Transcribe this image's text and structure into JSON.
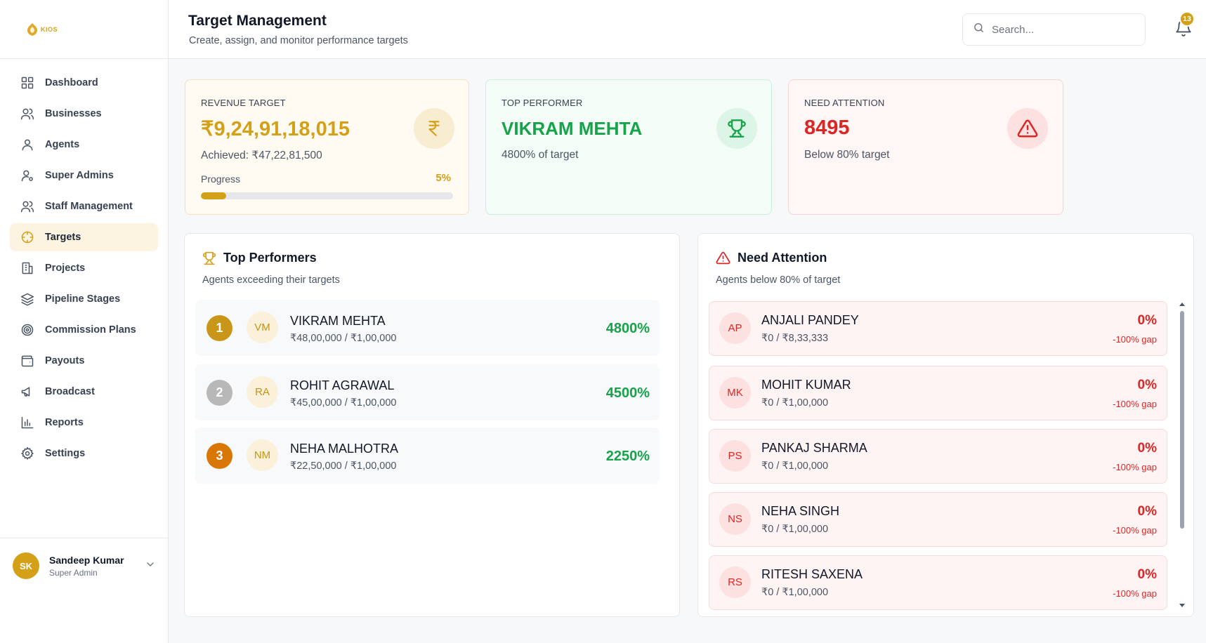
{
  "app": {
    "logo_text": "KIOS"
  },
  "sidebar": {
    "items": [
      {
        "label": "Dashboard",
        "icon": "grid-icon"
      },
      {
        "label": "Businesses",
        "icon": "users-icon"
      },
      {
        "label": "Agents",
        "icon": "user-icon"
      },
      {
        "label": "Super Admins",
        "icon": "user-cog-icon"
      },
      {
        "label": "Staff Management",
        "icon": "users-icon"
      },
      {
        "label": "Targets",
        "icon": "target-icon",
        "active": true
      },
      {
        "label": "Projects",
        "icon": "building-icon"
      },
      {
        "label": "Pipeline Stages",
        "icon": "layers-icon"
      },
      {
        "label": "Commission Plans",
        "icon": "radio-target-icon"
      },
      {
        "label": "Payouts",
        "icon": "wallet-icon"
      },
      {
        "label": "Broadcast",
        "icon": "megaphone-icon"
      },
      {
        "label": "Reports",
        "icon": "bar-chart-icon"
      },
      {
        "label": "Settings",
        "icon": "gear-icon"
      }
    ],
    "user": {
      "initials": "SK",
      "name": "Sandeep Kumar",
      "role": "Super Admin"
    }
  },
  "header": {
    "title": "Target Management",
    "subtitle": "Create, assign, and monitor performance targets",
    "search_placeholder": "Search...",
    "notification_count": "13"
  },
  "stats": {
    "revenue": {
      "label": "REVENUE TARGET",
      "value": "₹9,24,91,18,015",
      "achieved": "Achieved: ₹47,22,81,500",
      "progress_label": "Progress",
      "progress_text": "5%",
      "progress_fraction": 0.05
    },
    "top_performer": {
      "label": "TOP PERFORMER",
      "value": "VIKRAM MEHTA",
      "sub": "4800% of target"
    },
    "need_attention": {
      "label": "NEED ATTENTION",
      "value": "8495",
      "sub": "Below 80% target"
    }
  },
  "top_performers": {
    "title": "Top Performers",
    "subtitle": "Agents exceeding their targets",
    "rows": [
      {
        "rank": "1",
        "initials": "VM",
        "name": "VIKRAM MEHTA",
        "amount": "₹48,00,000 / ₹1,00,000",
        "pct": "4800%",
        "rank_color": "#c9961a"
      },
      {
        "rank": "2",
        "initials": "RA",
        "name": "ROHIT AGRAWAL",
        "amount": "₹45,00,000 / ₹1,00,000",
        "pct": "4500%",
        "rank_color": "#b8b8b8"
      },
      {
        "rank": "3",
        "initials": "NM",
        "name": "NEHA MALHOTRA",
        "amount": "₹22,50,000 / ₹1,00,000",
        "pct": "2250%",
        "rank_color": "#d97706"
      }
    ]
  },
  "need_attention": {
    "title": "Need Attention",
    "subtitle": "Agents below 80% of target",
    "rows": [
      {
        "initials": "AP",
        "name": "ANJALI PANDEY",
        "amount": "₹0 / ₹8,33,333",
        "pct": "0%",
        "gap": "-100% gap"
      },
      {
        "initials": "MK",
        "name": "MOHIT KUMAR",
        "amount": "₹0 / ₹1,00,000",
        "pct": "0%",
        "gap": "-100% gap"
      },
      {
        "initials": "PS",
        "name": "PANKAJ SHARMA",
        "amount": "₹0 / ₹1,00,000",
        "pct": "0%",
        "gap": "-100% gap"
      },
      {
        "initials": "NS",
        "name": "NEHA SINGH",
        "amount": "₹0 / ₹1,00,000",
        "pct": "0%",
        "gap": "-100% gap"
      },
      {
        "initials": "RS",
        "name": "RITESH SAXENA",
        "amount": "₹0 / ₹1,00,000",
        "pct": "0%",
        "gap": "-100% gap"
      }
    ]
  },
  "colors": {
    "accent": "#d4a017",
    "success": "#16a34a",
    "danger": "#dc2626"
  }
}
